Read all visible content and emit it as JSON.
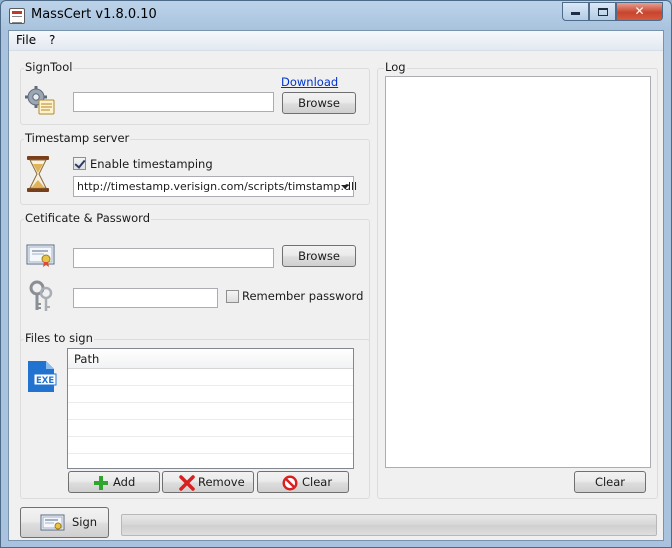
{
  "window": {
    "title": "MassCert v1.8.0.10"
  },
  "menu": {
    "file": "File",
    "help": "?"
  },
  "signtool": {
    "label": "SignTool",
    "download_link": "Download",
    "path_value": "",
    "browse_label": "Browse"
  },
  "timestamp": {
    "label": "Timestamp server",
    "enable_label": "Enable timestamping",
    "enabled": true,
    "server_url": "http://timestamp.verisign.com/scripts/timstamp.dll"
  },
  "certificate": {
    "label": "Cetificate & Password",
    "cert_path_value": "",
    "browse_label": "Browse",
    "password_value": "",
    "remember_label": "Remember password",
    "remember_checked": false
  },
  "files": {
    "label": "Files to sign",
    "column_path": "Path",
    "rows": [],
    "add_label": "Add",
    "remove_label": "Remove",
    "clear_label": "Clear"
  },
  "log": {
    "label": "Log",
    "content": "",
    "clear_label": "Clear"
  },
  "bottom": {
    "sign_label": "Sign",
    "progress": 0
  },
  "colors": {
    "titlebar": "#a9c3de",
    "client_bg": "#f0f0f0",
    "link": "#0033cc",
    "add_green": "#2fa52f",
    "remove_red": "#d82020",
    "exe_blue": "#2273d0"
  }
}
